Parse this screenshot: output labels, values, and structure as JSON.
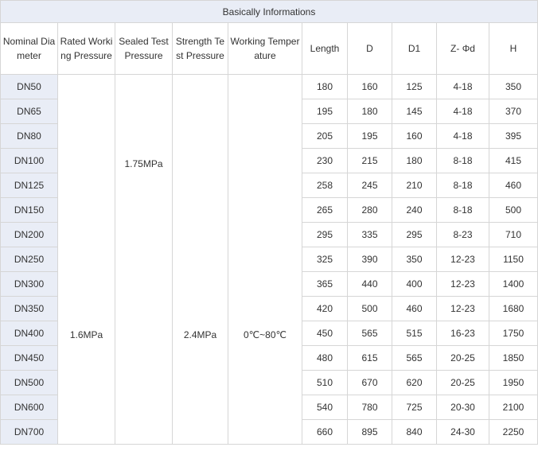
{
  "title": "Basically Informations",
  "headers": [
    "Nominal Diameter",
    "Rated Working Pressure",
    "Sealed Test Pressure",
    "Strength Test Pressure",
    "Working Temperature",
    "Length",
    "D",
    "D1",
    "Z- Φd",
    "H"
  ],
  "merged": {
    "rated_working_pressure": "1.6MPa",
    "sealed_test_pressure": "1.75MPa",
    "strength_test_pressure": "2.4MPa",
    "working_temperature": "0℃~80℃"
  },
  "rows": [
    {
      "dn": "DN50",
      "length": "180",
      "d": "160",
      "d1": "125",
      "z": "4-18",
      "h": "350"
    },
    {
      "dn": "DN65",
      "length": "195",
      "d": "180",
      "d1": "145",
      "z": "4-18",
      "h": "370"
    },
    {
      "dn": "DN80",
      "length": "205",
      "d": "195",
      "d1": "160",
      "z": "4-18",
      "h": "395"
    },
    {
      "dn": "DN100",
      "length": "230",
      "d": "215",
      "d1": "180",
      "z": "8-18",
      "h": "415"
    },
    {
      "dn": "DN125",
      "length": "258",
      "d": "245",
      "d1": "210",
      "z": "8-18",
      "h": "460"
    },
    {
      "dn": "DN150",
      "length": "265",
      "d": "280",
      "d1": "240",
      "z": "8-18",
      "h": "500"
    },
    {
      "dn": "DN200",
      "length": "295",
      "d": "335",
      "d1": "295",
      "z": "8-23",
      "h": "710"
    },
    {
      "dn": "DN250",
      "length": "325",
      "d": "390",
      "d1": "350",
      "z": "12-23",
      "h": "1150"
    },
    {
      "dn": "DN300",
      "length": "365",
      "d": "440",
      "d1": "400",
      "z": "12-23",
      "h": "1400"
    },
    {
      "dn": "DN350",
      "length": "420",
      "d": "500",
      "d1": "460",
      "z": "12-23",
      "h": "1680"
    },
    {
      "dn": "DN400",
      "length": "450",
      "d": "565",
      "d1": "515",
      "z": "16-23",
      "h": "1750"
    },
    {
      "dn": "DN450",
      "length": "480",
      "d": "615",
      "d1": "565",
      "z": "20-25",
      "h": "1850"
    },
    {
      "dn": "DN500",
      "length": "510",
      "d": "670",
      "d1": "620",
      "z": "20-25",
      "h": "1950"
    },
    {
      "dn": "DN600",
      "length": "540",
      "d": "780",
      "d1": "725",
      "z": "20-30",
      "h": "2100"
    },
    {
      "dn": "DN700",
      "length": "660",
      "d": "895",
      "d1": "840",
      "z": "24-30",
      "h": "2250"
    }
  ]
}
